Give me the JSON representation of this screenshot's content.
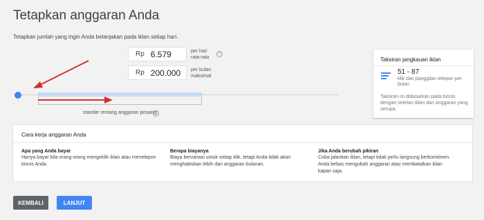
{
  "page": {
    "title": "Tetapkan anggaran Anda",
    "subtitle": "Tetapkan jumlah yang ingin Anda belanjakan pada iklan setiap hari."
  },
  "budget": {
    "currency": "Rp",
    "daily_value": "6.579",
    "daily_label_1": "per hari",
    "daily_label_2": "rata-rata",
    "monthly_value": "200.000",
    "monthly_label_1": "per bulan",
    "monthly_label_2": "maksimal",
    "help_glyph": "?"
  },
  "slider": {
    "range_label": "standar rentang anggaran pesaing"
  },
  "estimate": {
    "title": "Taksiran jangkauan iklan",
    "range": "51 - 87",
    "description": "klik dan panggilan telepon per bulan",
    "note": "Taksiran ini didasarkan pada bisnis dengan setelan iklan dan anggaran yang serupa.",
    "icon": "bar-chart-icon"
  },
  "how_it_works": {
    "title": "Cara kerja anggaran Anda",
    "columns": [
      {
        "heading": "Apa yang Anda bayar",
        "body": "Hanya bayar bila orang-orang mengeklik iklan atau menelepon bisnis Anda."
      },
      {
        "heading": "Berapa biayanya",
        "body": "Biaya bervariasi untuk setiap klik, tetapi Anda tidak akan menghabiskan lebih dari anggaran bulanan."
      },
      {
        "heading": "Jika Anda berubah pikiran",
        "body": "Coba jalankan iklan, tetapi tidak perlu langsung berkomitmen. Anda bebas mengubah anggaran atau membatalkan iklan kapan saja."
      }
    ]
  },
  "buttons": {
    "back": "KEMBALI",
    "next": "LANJUT"
  },
  "colors": {
    "accent": "#4285f4",
    "annotation_arrow": "#d32f2f",
    "secondary_button": "#5f6368"
  }
}
